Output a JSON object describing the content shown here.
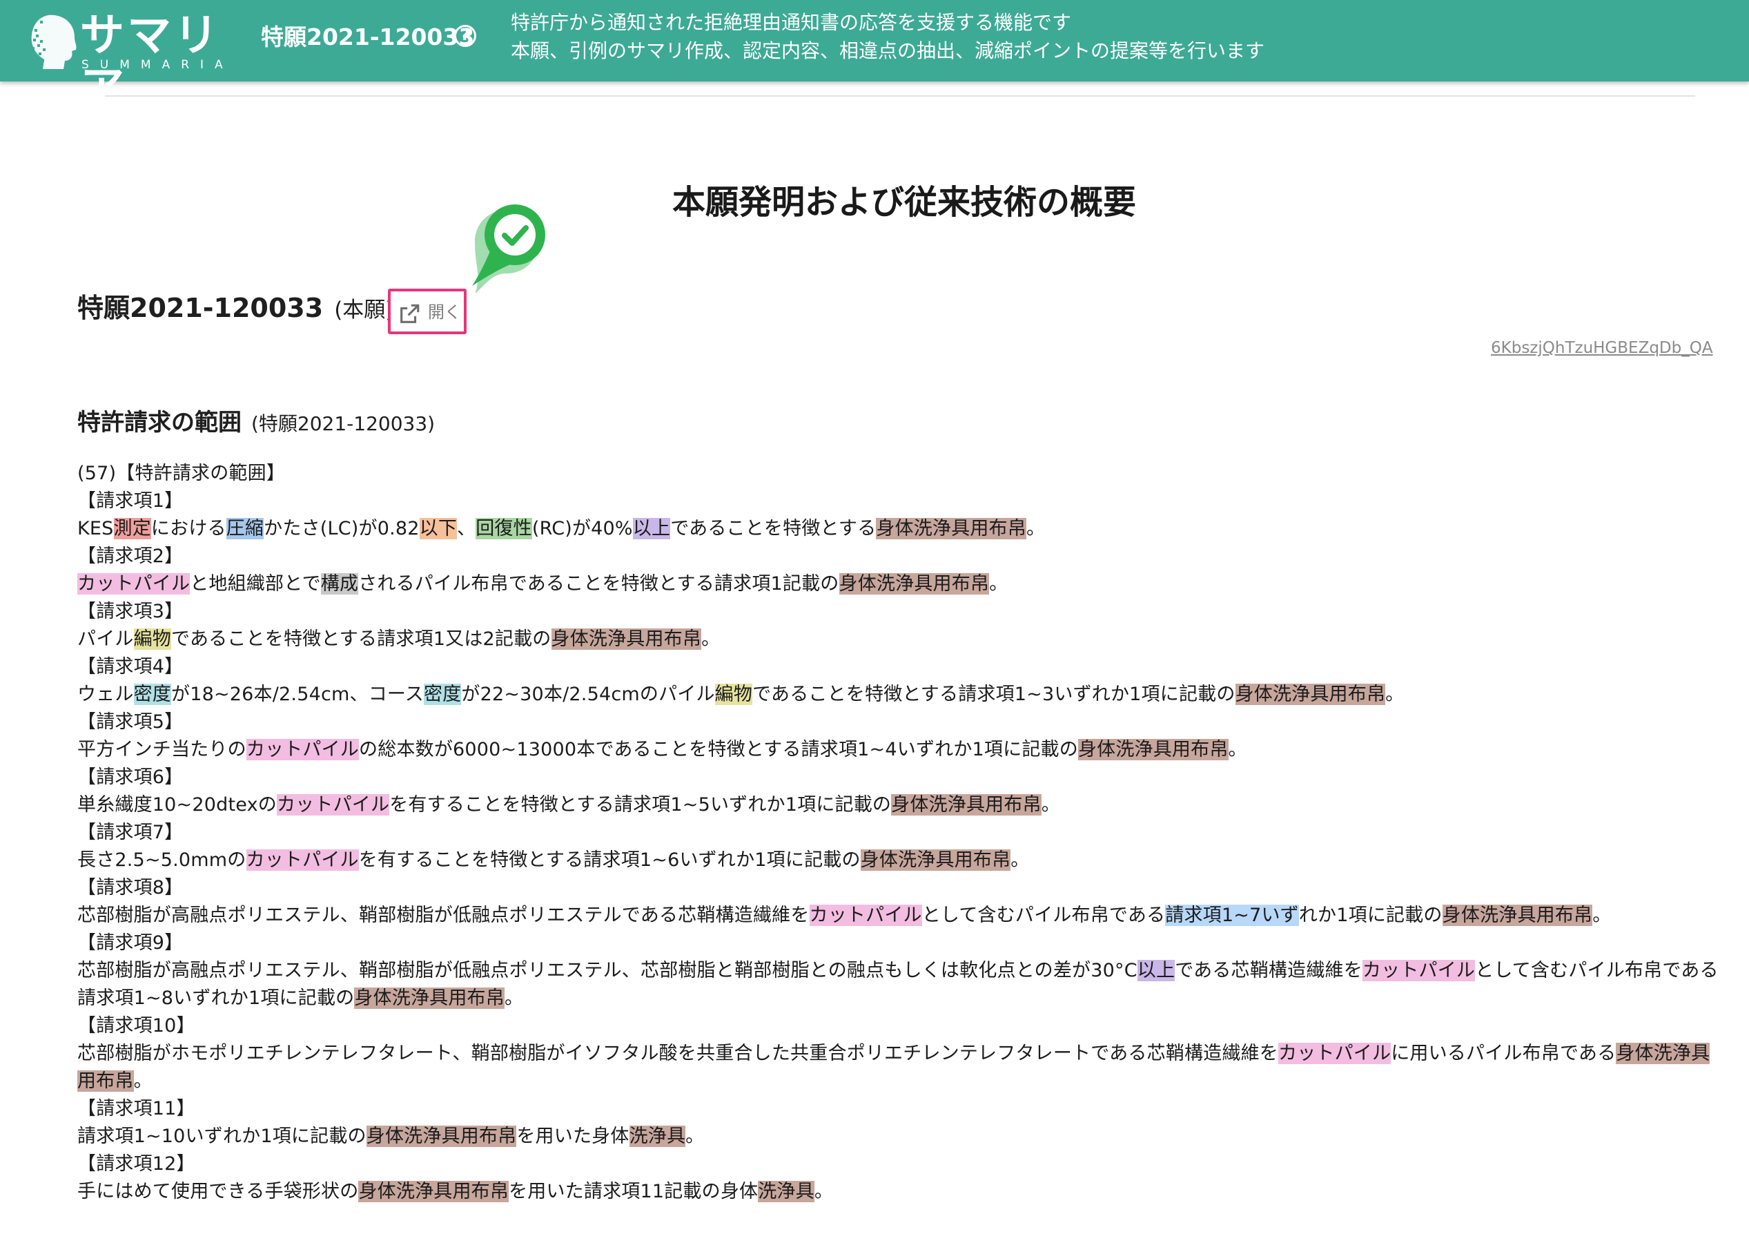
{
  "header": {
    "logo_jp": "サマリア",
    "logo_en": "SUMMARIA",
    "app_number": "特願2021-120033",
    "help_icon": "?",
    "description_line1": "特許庁から通知された拒絶理由通知書の応答を支援する機能です",
    "description_line2": "本願、引例のサマリ作成、認定内容、相違点の抽出、減縮ポイントの提案等を行います",
    "color": "#3daa96"
  },
  "main": {
    "title": "本願発明および従来技術の概要",
    "app_heading": "特願2021-120033",
    "app_kind": "(本願)",
    "open_label": "開く",
    "doc_id": "6KbszjQhTzuHGBEZqDb_QA",
    "claims_title": "特許請求の範囲",
    "claims_subtitle": "(特願2021-120033)"
  },
  "claims": {
    "intro": "(57)【特許請求の範囲】",
    "lines": [
      {
        "segments": [
          {
            "text": "【請求項1】"
          }
        ]
      },
      {
        "segments": [
          {
            "text": "KES"
          },
          {
            "text": "測定",
            "hl": "red"
          },
          {
            "text": "における"
          },
          {
            "text": "圧縮",
            "hl": "blue"
          },
          {
            "text": "かたさ(LC)が0.82"
          },
          {
            "text": "以下",
            "hl": "orange"
          },
          {
            "text": "、"
          },
          {
            "text": "回復性",
            "hl": "green"
          },
          {
            "text": "(RC)が40%"
          },
          {
            "text": "以上",
            "hl": "purple"
          },
          {
            "text": "であることを特徴とする"
          },
          {
            "text": "身体洗浄具用布帛",
            "hl": "brown"
          },
          {
            "text": "。"
          }
        ]
      },
      {
        "segments": [
          {
            "text": "【請求項2】"
          }
        ]
      },
      {
        "segments": [
          {
            "text": "カットパイル",
            "hl": "pink"
          },
          {
            "text": "と地組織部とで"
          },
          {
            "text": "構成",
            "hl": "gray"
          },
          {
            "text": "されるパイル布帛であることを特徴とする請求項1記載の"
          },
          {
            "text": "身体洗浄具用布帛",
            "hl": "brown"
          },
          {
            "text": "。"
          }
        ]
      },
      {
        "segments": [
          {
            "text": "【請求項3】"
          }
        ]
      },
      {
        "segments": [
          {
            "text": "パイル"
          },
          {
            "text": "編物",
            "hl": "yellow"
          },
          {
            "text": "であることを特徴とする請求項1又は2記載の"
          },
          {
            "text": "身体洗浄具用布帛",
            "hl": "brown"
          },
          {
            "text": "。"
          }
        ]
      },
      {
        "segments": [
          {
            "text": "【請求項4】"
          }
        ]
      },
      {
        "segments": [
          {
            "text": "ウェル"
          },
          {
            "text": "密度",
            "hl": "cyan"
          },
          {
            "text": "が18~26本/2.54cm、コース"
          },
          {
            "text": "密度",
            "hl": "cyan"
          },
          {
            "text": "が22~30本/2.54cmのパイル"
          },
          {
            "text": "編物",
            "hl": "yellow"
          },
          {
            "text": "であることを特徴とする請求項1~3いずれか1項に記載の"
          },
          {
            "text": "身体洗浄具用布帛",
            "hl": "brown"
          },
          {
            "text": "。"
          }
        ]
      },
      {
        "segments": [
          {
            "text": "【請求項5】"
          }
        ]
      },
      {
        "segments": [
          {
            "text": "平方インチ当たりの"
          },
          {
            "text": "カットパイル",
            "hl": "pink"
          },
          {
            "text": "の総本数が6000~13000本であることを特徴とする請求項1~4いずれか1項に記載の"
          },
          {
            "text": "身体洗浄具用布帛",
            "hl": "brown"
          },
          {
            "text": "。"
          }
        ]
      },
      {
        "segments": [
          {
            "text": "【請求項6】"
          }
        ]
      },
      {
        "segments": [
          {
            "text": "単糸繊度10~20dtexの"
          },
          {
            "text": "カットパイル",
            "hl": "pink"
          },
          {
            "text": "を有することを特徴とする請求項1~5いずれか1項に記載の"
          },
          {
            "text": "身体洗浄具用布帛",
            "hl": "brown"
          },
          {
            "text": "。"
          }
        ]
      },
      {
        "segments": [
          {
            "text": "【請求項7】"
          }
        ]
      },
      {
        "segments": [
          {
            "text": "長さ2.5~5.0mmの"
          },
          {
            "text": "カットパイル",
            "hl": "pink"
          },
          {
            "text": "を有することを特徴とする請求項1~6いずれか1項に記載の"
          },
          {
            "text": "身体洗浄具用布帛",
            "hl": "brown"
          },
          {
            "text": "。"
          }
        ]
      },
      {
        "segments": [
          {
            "text": "【請求項8】"
          }
        ]
      },
      {
        "segments": [
          {
            "text": "芯部樹脂が高融点ポリエステル、鞘部樹脂が低融点ポリエステルである芯鞘構造繊維を"
          },
          {
            "text": "カットパイル",
            "hl": "pink"
          },
          {
            "text": "として含むパイル布帛である"
          },
          {
            "text": "請求項1~7いず",
            "hl": "lblue"
          },
          {
            "text": "れか1項に記載の"
          },
          {
            "text": "身体洗浄具用布帛",
            "hl": "brown"
          },
          {
            "text": "。"
          }
        ]
      },
      {
        "segments": [
          {
            "text": "【請求項9】"
          }
        ]
      },
      {
        "segments": [
          {
            "text": "芯部樹脂が高融点ポリエステル、鞘部樹脂が低融点ポリエステル、芯部樹脂と鞘部樹脂との融点もしくは軟化点との差が30°C"
          },
          {
            "text": "以上",
            "hl": "purple"
          },
          {
            "text": "である芯鞘構造繊維を"
          },
          {
            "text": "カットパイル",
            "hl": "pink"
          },
          {
            "text": "として含むパイル布帛である請求項1~8いずれか1項に記載の"
          },
          {
            "text": "身体洗浄具用布帛",
            "hl": "brown"
          },
          {
            "text": "。"
          }
        ]
      },
      {
        "segments": [
          {
            "text": "【請求項10】"
          }
        ]
      },
      {
        "segments": [
          {
            "text": "芯部樹脂がホモポリエチレンテレフタレート、鞘部樹脂がイソフタル酸を共重合した共重合ポリエチレンテレフタレートである芯鞘構造繊維を"
          },
          {
            "text": "カットパイル",
            "hl": "pink"
          },
          {
            "text": "に用いるパイル布帛である"
          },
          {
            "text": "身体洗浄具用布帛",
            "hl": "brown"
          },
          {
            "text": "。"
          }
        ]
      },
      {
        "segments": [
          {
            "text": "【請求項11】"
          }
        ]
      },
      {
        "segments": [
          {
            "text": "請求項1~10いずれか1項に記載の"
          },
          {
            "text": "身体洗浄具用布帛",
            "hl": "brown"
          },
          {
            "text": "を用いた身体"
          },
          {
            "text": "洗浄具",
            "hl": "brown"
          },
          {
            "text": "。"
          }
        ]
      },
      {
        "segments": [
          {
            "text": "【請求項12】"
          }
        ]
      },
      {
        "segments": [
          {
            "text": "手にはめて使用できる手袋形状の"
          },
          {
            "text": "身体洗浄具用布帛",
            "hl": "brown"
          },
          {
            "text": "を用いた請求項11記載の身体"
          },
          {
            "text": "洗浄具",
            "hl": "brown"
          },
          {
            "text": "。"
          }
        ]
      }
    ]
  }
}
